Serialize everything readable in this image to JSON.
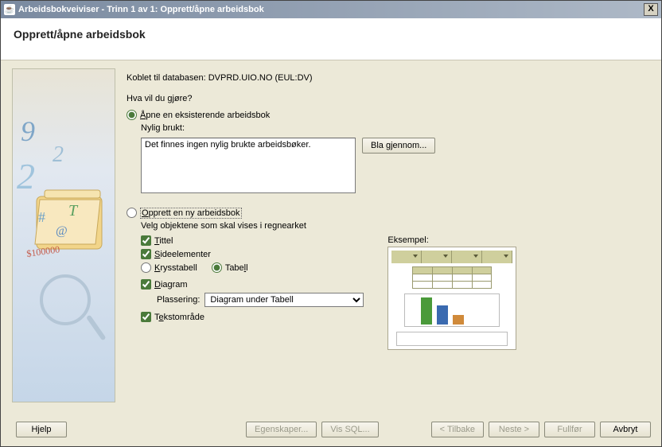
{
  "window": {
    "title": "Arbeidsbokveiviser - Trinn 1 av 1: Opprett/åpne arbeidsbok",
    "close_icon": "X"
  },
  "header": {
    "title": "Opprett/åpne arbeidsbok"
  },
  "main": {
    "connected_label": "Koblet til databasen: DVPRD.UIO.NO (EUL:DV)",
    "question": "Hva vil du gjøre?",
    "open_existing_label": "Åpne en eksisterende arbeidsbok",
    "recent_label": "Nylig brukt:",
    "recent_empty": "Det finnes ingen nylig brukte arbeidsbøker.",
    "browse_label": "Bla gjennom...",
    "create_new_label": "Opprett en ny arbeidsbok",
    "choose_objects_label": "Velg objektene som skal vises i regnearket",
    "checks": {
      "title": "Tittel",
      "page_items": "Sideelementer",
      "crosstab": "Krysstabell",
      "table": "Tabell",
      "diagram": "Diagram",
      "text_area": "Tekstområde"
    },
    "placement_label": "Plassering:",
    "placement_value": "Diagram under Tabell",
    "example_label": "Eksempel:"
  },
  "buttons": {
    "help": "Hjelp",
    "properties": "Egenskaper...",
    "show_sql": "Vis SQL...",
    "back": "< Tilbake",
    "next": "Neste >",
    "finish": "Fullfør",
    "cancel": "Avbryt"
  }
}
